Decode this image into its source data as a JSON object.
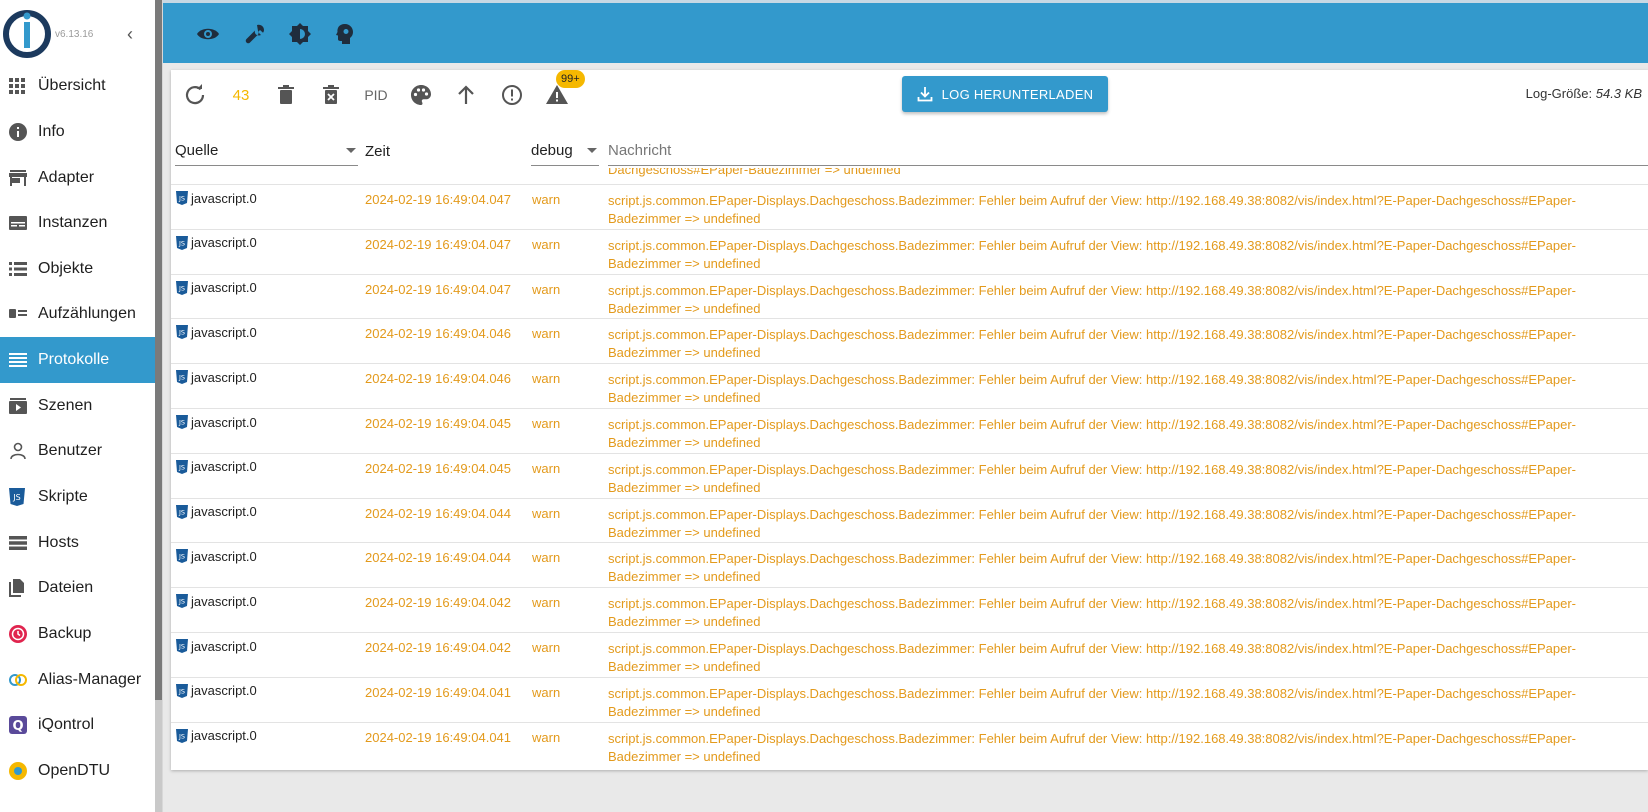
{
  "app": {
    "version": "v6.13.16"
  },
  "sidebar": {
    "items": [
      {
        "label": "Übersicht",
        "icon": "grid-icon"
      },
      {
        "label": "Info",
        "icon": "info-icon"
      },
      {
        "label": "Adapter",
        "icon": "store-icon"
      },
      {
        "label": "Instanzen",
        "icon": "instances-icon"
      },
      {
        "label": "Objekte",
        "icon": "list-icon"
      },
      {
        "label": "Aufzählungen",
        "icon": "enum-icon"
      },
      {
        "label": "Protokolle",
        "icon": "log-icon",
        "active": true
      },
      {
        "label": "Szenen",
        "icon": "scenes-icon"
      },
      {
        "label": "Benutzer",
        "icon": "user-icon"
      },
      {
        "label": "Skripte",
        "icon": "js-icon"
      },
      {
        "label": "Hosts",
        "icon": "hosts-icon"
      },
      {
        "label": "Dateien",
        "icon": "files-icon"
      },
      {
        "label": "Backup",
        "icon": "backup-icon"
      },
      {
        "label": "Alias-Manager",
        "icon": "alias-icon"
      },
      {
        "label": "iQontrol",
        "icon": "iqontrol-icon"
      },
      {
        "label": "OpenDTU",
        "icon": "opendtu-icon"
      }
    ]
  },
  "topbar": {
    "icons": [
      "eye-icon",
      "wrench-icon",
      "brightness-icon",
      "expert-mode-icon"
    ]
  },
  "toolbar": {
    "count": "43",
    "pid": "PID",
    "badge": "99+",
    "download_label": "LOG HERUNTERLADEN",
    "log_size_label": "Log-Größe:",
    "log_size_value": "54.3 KB"
  },
  "table": {
    "headers": {
      "source": "Quelle",
      "time": "Zeit",
      "severity": "debug",
      "message": "Nachricht"
    },
    "partial_text": "Dachgeschoss#EPaper-Badezimmer => undefined",
    "rows": [
      {
        "source": "javascript.0",
        "time": "2024-02-19 16:49:04.047",
        "severity": "warn",
        "message": "script.js.common.EPaper-Displays.Dachgeschoss.Badezimmer: Fehler beim Aufruf der View: http://192.168.49.38:8082/vis/index.html?E-Paper-Dachgeschoss#EPaper-Badezimmer => undefined"
      },
      {
        "source": "javascript.0",
        "time": "2024-02-19 16:49:04.047",
        "severity": "warn",
        "message": "script.js.common.EPaper-Displays.Dachgeschoss.Badezimmer: Fehler beim Aufruf der View: http://192.168.49.38:8082/vis/index.html?E-Paper-Dachgeschoss#EPaper-Badezimmer => undefined"
      },
      {
        "source": "javascript.0",
        "time": "2024-02-19 16:49:04.047",
        "severity": "warn",
        "message": "script.js.common.EPaper-Displays.Dachgeschoss.Badezimmer: Fehler beim Aufruf der View: http://192.168.49.38:8082/vis/index.html?E-Paper-Dachgeschoss#EPaper-Badezimmer => undefined"
      },
      {
        "source": "javascript.0",
        "time": "2024-02-19 16:49:04.046",
        "severity": "warn",
        "message": "script.js.common.EPaper-Displays.Dachgeschoss.Badezimmer: Fehler beim Aufruf der View: http://192.168.49.38:8082/vis/index.html?E-Paper-Dachgeschoss#EPaper-Badezimmer => undefined"
      },
      {
        "source": "javascript.0",
        "time": "2024-02-19 16:49:04.046",
        "severity": "warn",
        "message": "script.js.common.EPaper-Displays.Dachgeschoss.Badezimmer: Fehler beim Aufruf der View: http://192.168.49.38:8082/vis/index.html?E-Paper-Dachgeschoss#EPaper-Badezimmer => undefined"
      },
      {
        "source": "javascript.0",
        "time": "2024-02-19 16:49:04.045",
        "severity": "warn",
        "message": "script.js.common.EPaper-Displays.Dachgeschoss.Badezimmer: Fehler beim Aufruf der View: http://192.168.49.38:8082/vis/index.html?E-Paper-Dachgeschoss#EPaper-Badezimmer => undefined"
      },
      {
        "source": "javascript.0",
        "time": "2024-02-19 16:49:04.045",
        "severity": "warn",
        "message": "script.js.common.EPaper-Displays.Dachgeschoss.Badezimmer: Fehler beim Aufruf der View: http://192.168.49.38:8082/vis/index.html?E-Paper-Dachgeschoss#EPaper-Badezimmer => undefined"
      },
      {
        "source": "javascript.0",
        "time": "2024-02-19 16:49:04.044",
        "severity": "warn",
        "message": "script.js.common.EPaper-Displays.Dachgeschoss.Badezimmer: Fehler beim Aufruf der View: http://192.168.49.38:8082/vis/index.html?E-Paper-Dachgeschoss#EPaper-Badezimmer => undefined"
      },
      {
        "source": "javascript.0",
        "time": "2024-02-19 16:49:04.044",
        "severity": "warn",
        "message": "script.js.common.EPaper-Displays.Dachgeschoss.Badezimmer: Fehler beim Aufruf der View: http://192.168.49.38:8082/vis/index.html?E-Paper-Dachgeschoss#EPaper-Badezimmer => undefined"
      },
      {
        "source": "javascript.0",
        "time": "2024-02-19 16:49:04.042",
        "severity": "warn",
        "message": "script.js.common.EPaper-Displays.Dachgeschoss.Badezimmer: Fehler beim Aufruf der View: http://192.168.49.38:8082/vis/index.html?E-Paper-Dachgeschoss#EPaper-Badezimmer => undefined"
      },
      {
        "source": "javascript.0",
        "time": "2024-02-19 16:49:04.042",
        "severity": "warn",
        "message": "script.js.common.EPaper-Displays.Dachgeschoss.Badezimmer: Fehler beim Aufruf der View: http://192.168.49.38:8082/vis/index.html?E-Paper-Dachgeschoss#EPaper-Badezimmer => undefined"
      },
      {
        "source": "javascript.0",
        "time": "2024-02-19 16:49:04.041",
        "severity": "warn",
        "message": "script.js.common.EPaper-Displays.Dachgeschoss.Badezimmer: Fehler beim Aufruf der View: http://192.168.49.38:8082/vis/index.html?E-Paper-Dachgeschoss#EPaper-Badezimmer => undefined"
      },
      {
        "source": "javascript.0",
        "time": "2024-02-19 16:49:04.041",
        "severity": "warn",
        "message": "script.js.common.EPaper-Displays.Dachgeschoss.Badezimmer: Fehler beim Aufruf der View: http://192.168.49.38:8082/vis/index.html?E-Paper-Dachgeschoss#EPaper-Badezimmer => undefined"
      }
    ]
  },
  "colors": {
    "primary": "#3399cc",
    "warn": "#e39a1c",
    "badge": "#f5b800"
  }
}
